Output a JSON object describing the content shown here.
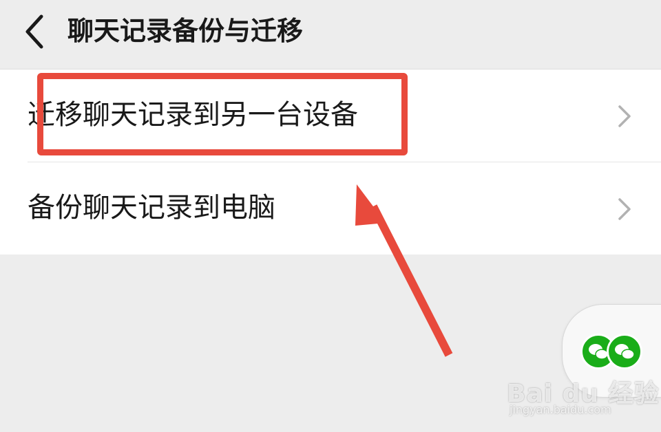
{
  "header": {
    "back_icon": "chevron-left-icon",
    "title": "聊天记录备份与迁移"
  },
  "menu": {
    "items": [
      {
        "label": "迁移聊天记录到另一台设备",
        "icon": "chevron-right-icon"
      },
      {
        "label": "备份聊天记录到电脑",
        "icon": "chevron-right-icon"
      }
    ]
  },
  "annotation": {
    "highlight_color": "#e84a3c"
  },
  "floating_widget": {
    "icon": "wechat-icon",
    "brand_color": "#1aad19"
  },
  "watermark": {
    "logo": "Bai du 经验",
    "url": "jingyan.baidu.com"
  }
}
